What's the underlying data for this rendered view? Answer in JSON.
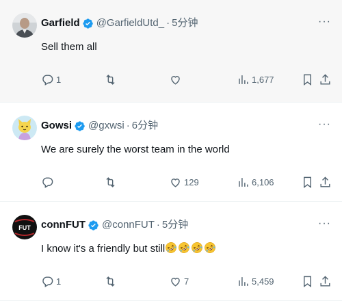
{
  "tweets": [
    {
      "name": "Garfield",
      "handle": "@GarfieldUtd_",
      "separator": "·",
      "time": "5分钟",
      "text": "Sell them all",
      "more": "···",
      "reply_count": "1",
      "retweet_count": "",
      "like_count": "",
      "views_count": "1,677"
    },
    {
      "name": "Gowsi",
      "handle": "@gxwsi",
      "separator": "·",
      "time": "6分钟",
      "text": "We are surely the worst team in the world",
      "more": "···",
      "reply_count": "",
      "retweet_count": "",
      "like_count": "129",
      "views_count": "6,106"
    },
    {
      "name": "connFUT",
      "handle": "@connFUT",
      "separator": "·",
      "time": "5分钟",
      "text": "I know it's a friendly but still",
      "emoji_count": 4,
      "avatar_text": "FUT",
      "more": "···",
      "reply_count": "1",
      "retweet_count": "",
      "like_count": "7",
      "views_count": "5,459"
    }
  ],
  "colors": {
    "verified": "#1d9bf0",
    "muted": "#536471",
    "text": "#0f1419",
    "first_row_bg": "#f7f7f7"
  },
  "icons": [
    "reply-icon",
    "retweet-icon",
    "like-icon",
    "views-icon",
    "bookmark-icon",
    "share-icon",
    "verified-badge-icon",
    "more-options-icon",
    "rolling-laughing-emoji-icon"
  ]
}
